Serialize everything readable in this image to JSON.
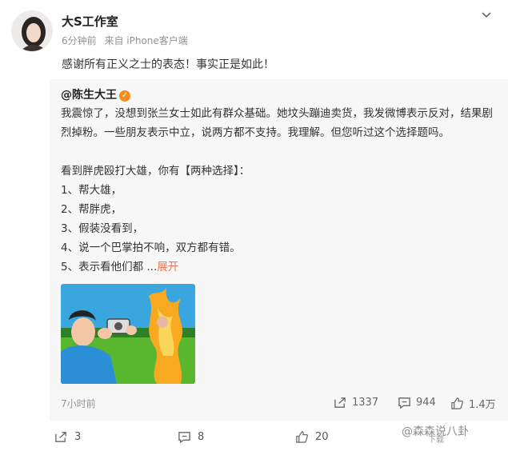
{
  "post": {
    "author": "大S工作室",
    "time": "6分钟前",
    "source": "来自 iPhone客户端",
    "text": "感谢所有正义之士的表态！事实正是如此！"
  },
  "repost": {
    "author": "@陈生大王",
    "paragraphs": [
      "我震惊了，没想到张兰女士如此有群众基础。她坟头蹦迪卖货，我发微博表示反对，结果剧烈掉粉。一些朋友表示中立，说两方都不支持。我理解。但您听过这个选择题吗。",
      "",
      "看到胖虎殴打大雄，你有【两种选择】：",
      "1、帮大雄，",
      "2、帮胖虎，",
      "3、假装没看到，",
      "4、说一个巴掌拍不响，双方都有错。"
    ],
    "last_line": "5、表示看他们都",
    "ellipsis": "...",
    "expand": "展开",
    "time": "7小时前",
    "reposts": "1337",
    "comments": "944",
    "likes": "1.4万"
  },
  "actions": {
    "reposts": "3",
    "comments": "8",
    "likes": "20"
  },
  "watermark": {
    "text": "@森森说八卦",
    "sub": "下载"
  },
  "icons": [
    "chevron-down-icon",
    "verified-icon",
    "repost-icon",
    "comment-icon",
    "like-icon"
  ],
  "colors": {
    "expand_link": "#eb7350",
    "verified_badge": "#f38d1e",
    "meta_gray": "#939393"
  }
}
